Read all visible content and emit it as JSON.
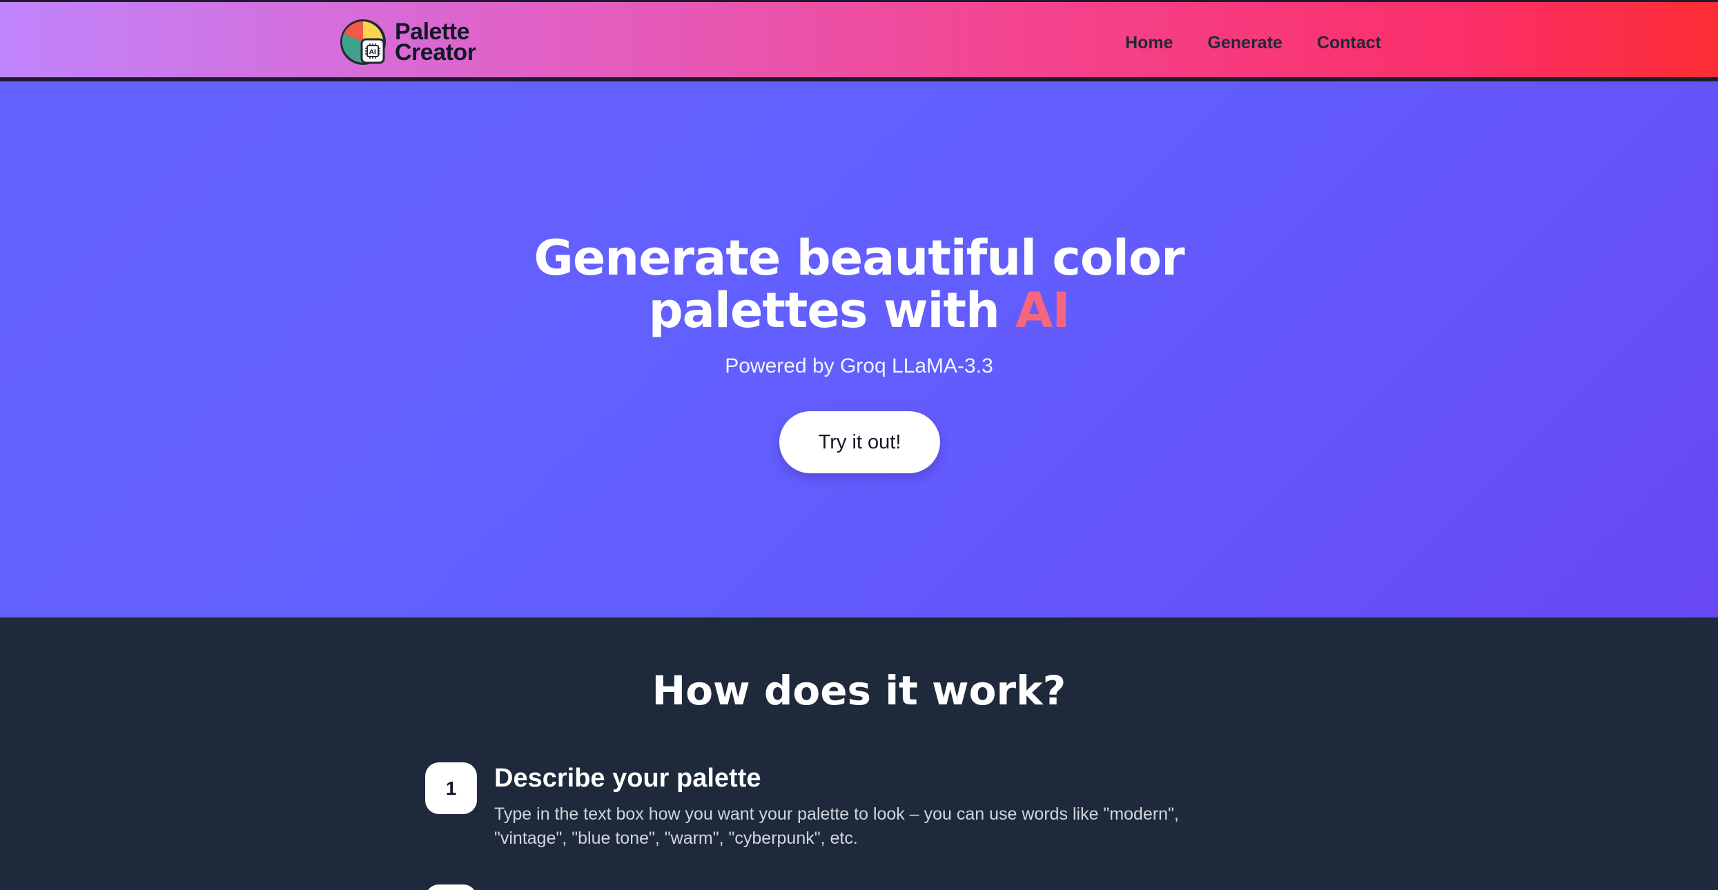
{
  "brand": {
    "line1": "Palette",
    "line2": "Creator",
    "logo_icon": "palette-ai-logo"
  },
  "nav": {
    "links": [
      "Home",
      "Generate",
      "Contact"
    ]
  },
  "hero": {
    "title_line1": "Generate beautiful color",
    "title_line2_prefix": "palettes with",
    "title_accent": "AI",
    "subtitle": "Powered by Groq LLaMA-3.3",
    "cta": "Try it out!"
  },
  "how": {
    "title": "How does it work?",
    "steps": [
      {
        "number": "1",
        "title": "Describe your palette",
        "description": "Type in the text box how you want your palette to look – you can use words like \"modern\", \"vintage\", \"blue tone\", \"warm\", \"cyberpunk\", etc."
      }
    ]
  },
  "colors": {
    "hero_bg": "#6462ff",
    "accent": "#f7657e",
    "dark_bg": "#1e293b",
    "nav_gradient_start": "#c084fc",
    "nav_gradient_end": "#fd2d34"
  }
}
